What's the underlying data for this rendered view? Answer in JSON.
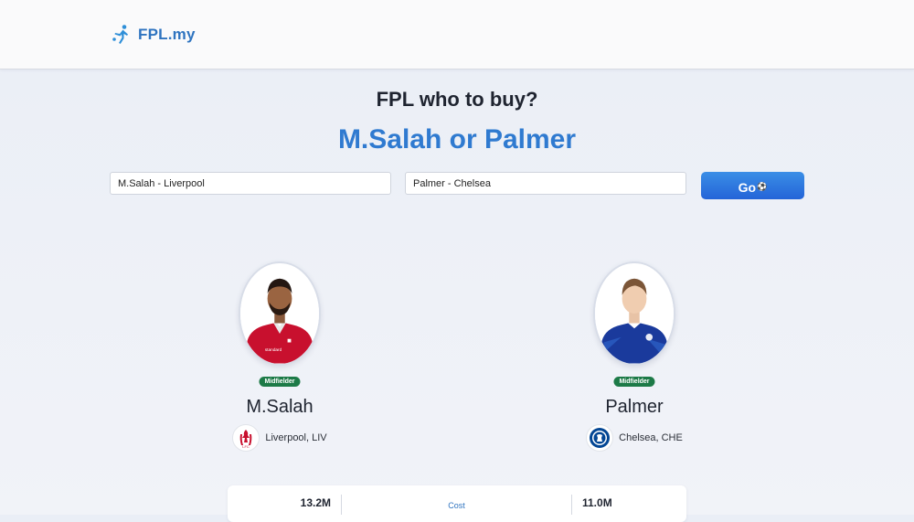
{
  "header": {
    "brand": "FPL.my",
    "logo_icon": "footballer-kick-icon"
  },
  "main": {
    "heading": "FPL who to buy?",
    "comparison_title": "M.Salah or Palmer",
    "inputs": [
      {
        "value": "M.Salah - Liverpool"
      },
      {
        "value": "Palmer - Chelsea"
      }
    ],
    "go_button": {
      "label": "Go",
      "icon": "⚽"
    }
  },
  "players": {
    "left": {
      "name": "M.Salah",
      "position": "Midfielder",
      "club": "Liverpool, LIV",
      "crest_icon": "liverpool-crest-icon",
      "kit_color": "#c8102e"
    },
    "right": {
      "name": "Palmer",
      "position": "Midfielder",
      "club": "Chelsea, CHE",
      "crest_icon": "chelsea-crest-icon",
      "kit_color": "#1a3a9c"
    }
  },
  "stats": {
    "rows": [
      {
        "left": "13.2M",
        "label": "Cost",
        "right": "11.0M"
      }
    ]
  },
  "colors": {
    "accent": "#2f7ad0",
    "badge": "#1c7a47",
    "button": "#2d79e0"
  }
}
